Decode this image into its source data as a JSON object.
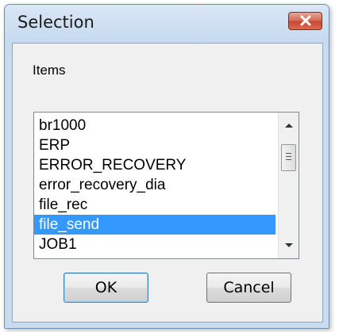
{
  "window": {
    "title": "Selection"
  },
  "items_label": "Items",
  "list": {
    "items": [
      {
        "label": "br1000",
        "selected": false
      },
      {
        "label": "ERP",
        "selected": false
      },
      {
        "label": "ERROR_RECOVERY",
        "selected": false
      },
      {
        "label": "error_recovery_dia",
        "selected": false
      },
      {
        "label": "file_rec",
        "selected": false
      },
      {
        "label": "file_send",
        "selected": true
      },
      {
        "label": "JOB1",
        "selected": false
      }
    ]
  },
  "buttons": {
    "ok_label": "OK",
    "cancel_label": "Cancel"
  },
  "colors": {
    "selection": "#3399ff",
    "close_button": "#c44a33",
    "window_frame": "#c9dbee"
  }
}
